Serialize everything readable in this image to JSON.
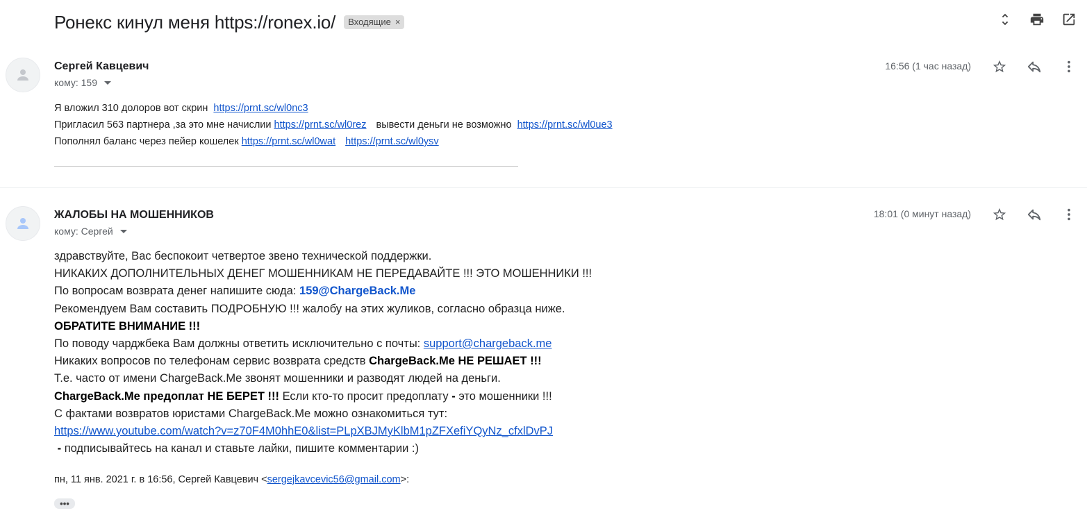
{
  "thread": {
    "subject": "Ронекс кинул меня https://ronex.io/",
    "label": "Входящие",
    "label_remove": "×"
  },
  "toolbar_icons": [
    "expand-collapse-icon",
    "print-icon",
    "open-in-new-window-icon"
  ],
  "message1": {
    "sender": "Сергей Кавцевич",
    "recipient": "кому: 159",
    "time": "16:56 (1 час назад)",
    "line1_text": "Я вложил 310 долоров вот скрин",
    "line1_link": "https://prnt.sc/wl0nc3",
    "line2_text": "Пригласил 563 партнера ,за это мне начислии",
    "line2_link1": "https://prnt.sc/wl0rez",
    "line2_text2": "вывести деньги не возможно",
    "line2_link2": "https://prnt.sc/wl0ue3",
    "line3_text": "Пополнял баланс через пейер кошелек",
    "line3_link1": "https://prnt.sc/wl0wat",
    "line3_link2": "https://prnt.sc/wl0ysv"
  },
  "message2": {
    "sender": "ЖАЛОБЫ НА МОШЕННИКОВ",
    "recipient": "кому: Сергей",
    "time": "18:01 (0 минут назад)",
    "l1": "здравствуйте, Вас беспокоит четвертое звено технической поддержки.",
    "l2": "НИКАКИХ ДОПОЛНИТЕЛЬНЫХ ДЕНЕГ МОШЕННИКАМ НЕ ПЕРЕДАВАЙТЕ !!! ЭТО МОШЕННИКИ !!!",
    "l3_text": "По вопросам возврата денег напишите сюда:",
    "l3_email": "159@ChargeBack.Me",
    "l4": "Рекомендуем Вам составить ПОДРОБНУЮ !!! жалобу на этих жуликов, согласно образца ниже.",
    "l5": "ОБРАТИТЕ ВНИМАНИЕ !!!",
    "l6_text": "По поводу чарджбека Вам должны ответить исключительно с почты:",
    "l6_email": "support@chargeback.me",
    "l7_text": "Никаких вопросов по телефонам сервис возврата средств",
    "l7_bold": "ChargeBack.Me НЕ РЕШАЕТ !!!",
    "l8": "Т.е. часто от имени ChargeBack.Me звонят мошенники и разводят людей на деньги.",
    "l9_bold": "ChargeBack.Me предоплат НЕ БЕРЕТ !!!",
    "l9_text": "Если кто-то просит предоплату",
    "l9_dash": "-",
    "l9_text2": "это мошенники !!!",
    "l10": "С фактами возвратов юристами ChargeBack.Me можно ознакомиться тут:",
    "l11_link": "https://www.youtube.com/watch?v=z70F4M0hhE0&list=PLpXBJMyKlbM1pZFXefiYQyNz_cfxlDvPJ",
    "l12_dash": "-",
    "l12_text": "подписывайтесь на канал и ставьте лайки, пишите комментарии :)",
    "quote_prefix": "пн, 11 янв. 2021 г. в 16:56, Сергей Кавцевич <",
    "quote_email": "sergejkavcevic56@gmail.com",
    "quote_suffix": ">:",
    "ellipsis": "•••"
  },
  "message_icons": [
    "star-icon",
    "reply-icon",
    "more-vert-icon"
  ]
}
